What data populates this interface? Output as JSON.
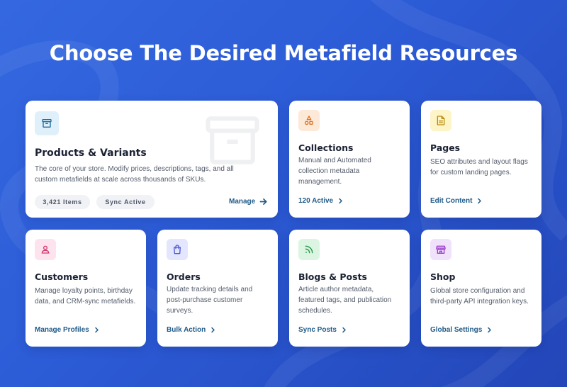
{
  "page": {
    "title": "Choose The Desired Metafield Resources"
  },
  "colors": {
    "background": "#2f60dc",
    "card": "#ffffff",
    "link": "#1f5a88",
    "title_text": "#1b2233"
  },
  "cards": {
    "products": {
      "icon": "archive-box-icon",
      "title": "Products & Variants",
      "description": "The core of your store. Modify prices, descriptions, tags, and all custom metafields at scale across thousands of SKUs.",
      "badge_items": "3,421 Items",
      "badge_status": "Sync Active",
      "link": "Manage"
    },
    "collections": {
      "icon": "shapes-icon",
      "title": "Collections",
      "description": "Manual and Automated collection metadata management.",
      "link": "120 Active"
    },
    "pages": {
      "icon": "document-icon",
      "title": "Pages",
      "description": "SEO attributes and layout flags for custom landing pages.",
      "link": "Edit Content"
    },
    "customers": {
      "icon": "user-icon",
      "title": "Customers",
      "description": "Manage loyalty points, birthday data, and CRM-sync metafields.",
      "link": "Manage Profiles"
    },
    "orders": {
      "icon": "shopping-bag-icon",
      "title": "Orders",
      "description": "Update tracking details and post-purchase customer surveys.",
      "link": "Bulk Action"
    },
    "blogs": {
      "icon": "rss-icon",
      "title": "Blogs & Posts",
      "description": "Article author metadata, featured tags, and publication schedules.",
      "link": "Sync Posts"
    },
    "shop": {
      "icon": "storefront-icon",
      "title": "Shop",
      "description": "Global store configuration and third-party API integration keys.",
      "link": "Global Settings"
    }
  }
}
